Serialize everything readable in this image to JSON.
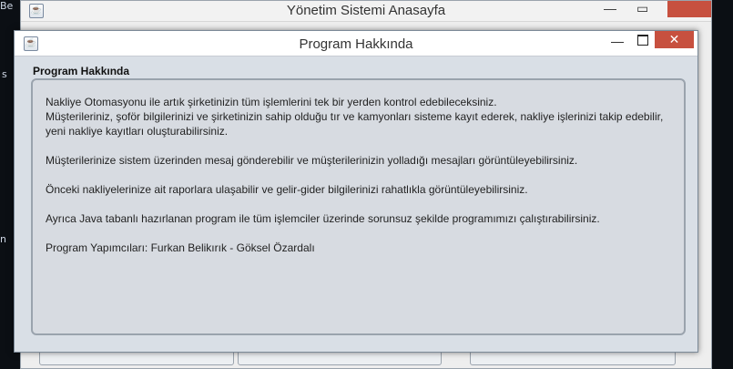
{
  "desktop": {
    "left_fragments": [
      "Be",
      "s",
      "n"
    ]
  },
  "background_window": {
    "title": "Yönetim Sistemi Anasayfa",
    "minimize_glyph": "—",
    "maximize_glyph": "▭",
    "close_glyph": ""
  },
  "dialog": {
    "title": "Program Hakkında",
    "minimize_glyph": "—",
    "close_glyph": "✕",
    "group_title": "Program Hakkında",
    "paragraphs": [
      "Nakliye Otomasyonu ile artık şirketinizin tüm işlemlerini tek bir yerden kontrol edebileceksiniz.\nMüşterileriniz, şoför bilgilerinizi ve şirketinizin sahip olduğu tır ve kamyonları sisteme kayıt ederek, nakliye işlerinizi takip edebilir, yeni nakliye kayıtları oluşturabilirsiniz.",
      "Müşterilerinize sistem üzerinden mesaj gönderebilir ve müşterilerinizin yolladığı mesajları görüntüleyebilirsiniz.",
      "Önceki nakliyelerinize ait raporlara ulaşabilir ve gelir-gider bilgilerinizi rahatlıkla görüntüleyebilirsiniz.",
      "Ayrıca Java tabanlı hazırlanan program ile tüm işlemciler üzerinde sorunsuz şekilde programımızı çalıştırabilirsiniz.",
      "Program Yapımcıları: Furkan Belikırık - Göksel Özardalı"
    ]
  }
}
